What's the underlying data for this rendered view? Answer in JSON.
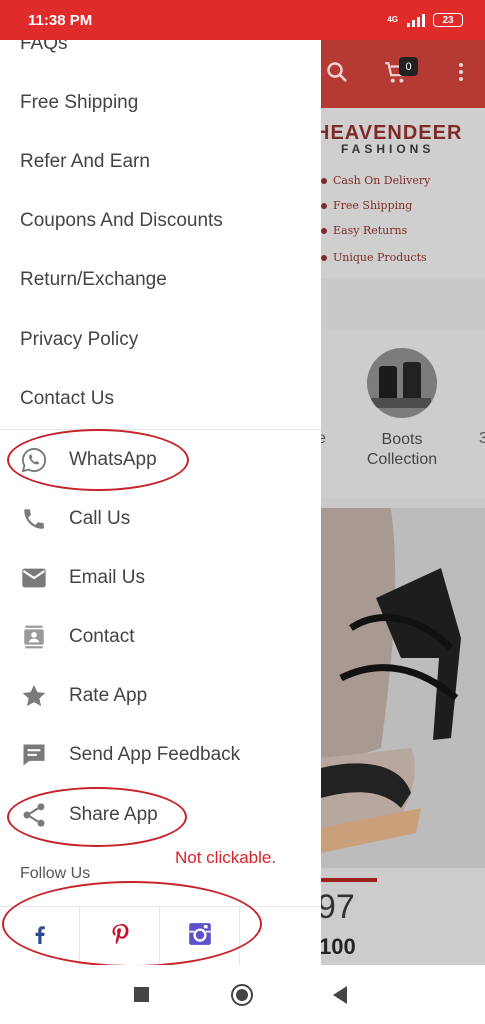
{
  "status_bar": {
    "time": "11:38 PM",
    "network": "4G",
    "battery": "23"
  },
  "background_app": {
    "cart_count": "0",
    "brand": "HEAVENDEER",
    "brand_sub": "FASHIONS",
    "features": [
      "Cash On Delivery",
      "Free Shipping",
      "Easy Returns",
      "Unique Products"
    ],
    "partial_category_left": "e",
    "partial_category_right": "3",
    "category_label_line1": "Boots",
    "category_label_line2": "Collection",
    "price_old": "97",
    "price_new": "100"
  },
  "drawer": {
    "menu_items": [
      {
        "label": "FAQs"
      },
      {
        "label": "Free Shipping"
      },
      {
        "label": "Refer And Earn"
      },
      {
        "label": "Coupons And Discounts"
      },
      {
        "label": "Return/Exchange"
      },
      {
        "label": "Privacy Policy"
      },
      {
        "label": "Contact Us"
      }
    ],
    "contact_items": [
      {
        "label": "WhatsApp",
        "icon": "whatsapp-icon"
      },
      {
        "label": "Call Us",
        "icon": "phone-icon"
      },
      {
        "label": "Email Us",
        "icon": "email-icon"
      },
      {
        "label": "Contact",
        "icon": "contact-card-icon"
      },
      {
        "label": "Rate App",
        "icon": "star-icon"
      },
      {
        "label": "Send App Feedback",
        "icon": "feedback-icon"
      },
      {
        "label": "Share App",
        "icon": "share-icon"
      }
    ],
    "follow_label": "Follow Us",
    "social": [
      "facebook-icon",
      "pinterest-icon",
      "instagram-icon"
    ]
  },
  "annotation": {
    "note": "Not clickable."
  },
  "colors": {
    "status_bar": "#e02b2b",
    "annotation": "#c72129",
    "facebook": "#2b4a8f",
    "pinterest": "#c8102e",
    "instagram": "#5b52c9"
  }
}
